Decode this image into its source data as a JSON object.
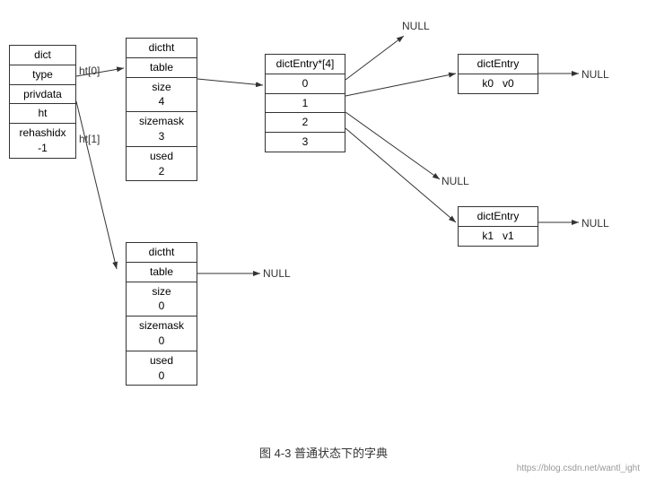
{
  "diagram": {
    "title": "图 4-3   普通状态下的字典",
    "watermark": "https://blog.csdn.net/wantl_ight",
    "dict_box": {
      "cells": [
        "dict",
        "type",
        "privdata",
        "ht",
        "rehashidx\n-1"
      ]
    },
    "ht_labels": [
      "ht[0]",
      "ht[1]"
    ],
    "dictht_top": {
      "cells": [
        "dictht",
        "table",
        "size\n4",
        "sizemask\n3",
        "used\n2"
      ]
    },
    "dictht_bottom": {
      "cells": [
        "dictht",
        "table",
        "size\n0",
        "sizemask\n0",
        "used\n0"
      ]
    },
    "dictentry_array": {
      "header": "dictEntry*[4]",
      "cells": [
        "0",
        "1",
        "2",
        "3"
      ]
    },
    "dictentry_top": {
      "cells": [
        "dictEntry",
        "k0    v0"
      ]
    },
    "dictentry_bottom": {
      "cells": [
        "dictEntry",
        "k1    v1"
      ]
    },
    "null_labels": [
      "NULL",
      "NULL",
      "NULL",
      "NULL",
      "NULL"
    ]
  }
}
